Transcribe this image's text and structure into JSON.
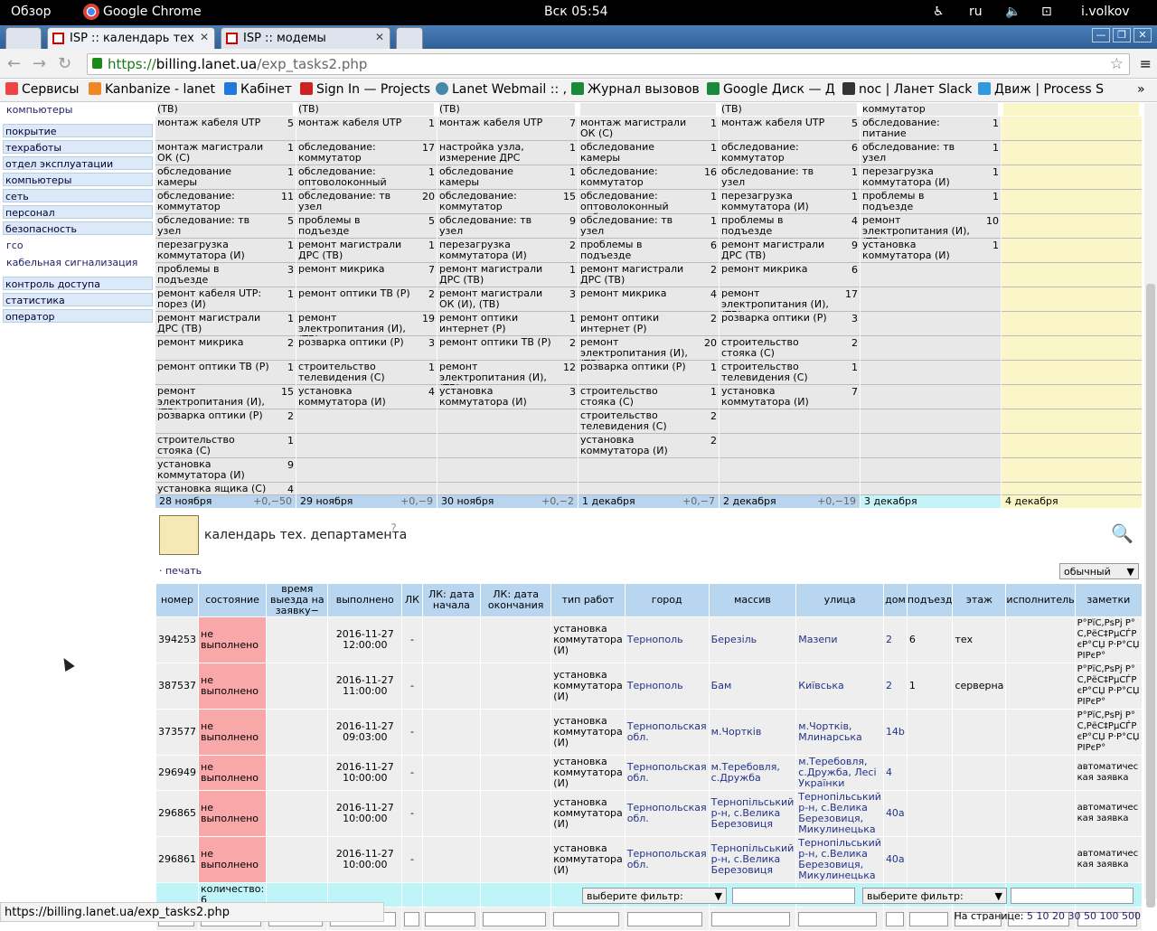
{
  "os": {
    "overview": "Обзор",
    "app": "Google Chrome",
    "clock": "Вск 05:54",
    "lang": "ru",
    "user": "i.volkov"
  },
  "tabs": [
    {
      "label": "ISP :: календарь тех"
    },
    {
      "label": "ISP :: модемы"
    }
  ],
  "address": {
    "scheme": "https://",
    "host": "billing.lanet.ua",
    "path": "/exp_tasks2.php"
  },
  "bookmarks": [
    "Сервисы",
    "Kanbanize - lanet",
    "Кабінет",
    "Sign In — Projects",
    "Lanet Webmail :: ,",
    "Журнал вызовов",
    "Google Диск — Д",
    "noc | Ланет Slack",
    "Движ | Process S"
  ],
  "sidebar": {
    "top_link": "компьютеры",
    "items": [
      "покрытие",
      "техработы",
      "отдел эксплуатации",
      "компьютеры",
      "сеть",
      "персонал",
      "безопасность"
    ],
    "sub_items": [
      "гсо",
      "кабельная сигнализация"
    ],
    "items2": [
      "контроль доступа",
      "статистика",
      "оператор"
    ]
  },
  "calendar": {
    "top_labels": [
      "(ТВ)",
      "(ТВ)",
      "(ТВ)",
      "",
      "(ТВ)",
      "коммутатор",
      ""
    ],
    "days": [
      {
        "date": "28 ноября",
        "delta": "+0,−50",
        "rows": [
          [
            "монтаж кабеля UTP",
            "5"
          ],
          [
            "монтаж магистрали ОК (С)",
            "1"
          ],
          [
            "обследование камеры",
            "1"
          ],
          [
            "обследование: коммутатор",
            "11"
          ],
          [
            "обследование: тв узел",
            "5"
          ],
          [
            "перезагрузка коммутатора (И)",
            "1"
          ],
          [
            "проблемы в подъезде",
            "3"
          ],
          [
            "ремонт кабеля UTP: порез (И)",
            "1"
          ],
          [
            "ремонт магистрали ДРС (ТВ)",
            "1"
          ],
          [
            "ремонт микрика",
            "2"
          ],
          [
            "ремонт оптики ТВ (Р)",
            "1"
          ],
          [
            "ремонт электропитания (И), (ТВ)",
            "15"
          ],
          [
            "розварка оптики (Р)",
            "2"
          ],
          [
            "строительство стояка (С)",
            "1"
          ],
          [
            "установка коммутатора (И)",
            "9"
          ],
          [
            "установка ящика (С)",
            "4"
          ]
        ]
      },
      {
        "date": "29 ноября",
        "delta": "+0,−9",
        "rows": [
          [
            "монтаж кабеля UTP",
            "1"
          ],
          [
            "обследование: коммутатор",
            "17"
          ],
          [
            "обследование: оптоволоконный кабель",
            "1"
          ],
          [
            "обследование: тв узел",
            "20"
          ],
          [
            "проблемы в подъезде",
            "5"
          ],
          [
            "ремонт магистрали ДРС (ТВ)",
            "1"
          ],
          [
            "ремонт микрика",
            "7"
          ],
          [
            "ремонт оптики ТВ (Р)",
            "2"
          ],
          [
            "ремонт электропитания (И), (ТВ)",
            "19"
          ],
          [
            "розварка оптики (Р)",
            "3"
          ],
          [
            "строительство телевидения (С)",
            "1"
          ],
          [
            "установка коммутатора (И)",
            "4"
          ]
        ]
      },
      {
        "date": "30 ноября",
        "delta": "+0,−2",
        "rows": [
          [
            "монтаж кабеля UTP",
            "7"
          ],
          [
            "настройка узла, измерение ДРС",
            "1"
          ],
          [
            "обследование камеры",
            "1"
          ],
          [
            "обследование: коммутатор",
            "15"
          ],
          [
            "обследование: тв узел",
            "9"
          ],
          [
            "перезагрузка коммутатора (И)",
            "2"
          ],
          [
            "ремонт магистрали ДРС (ТВ)",
            "1"
          ],
          [
            "ремонт магистрали ОК (И), (ТВ)",
            "3"
          ],
          [
            "ремонт оптики интернет (Р)",
            "1"
          ],
          [
            "ремонт оптики ТВ (Р)",
            "2"
          ],
          [
            "ремонт электропитания (И), (ТВ)",
            "12"
          ],
          [
            "установка коммутатора (И)",
            "3"
          ]
        ]
      },
      {
        "date": "1 декабря",
        "delta": "+0,−7",
        "rows": [
          [
            "монтаж магистрали ОК (С)",
            "1"
          ],
          [
            "обследование камеры",
            "1"
          ],
          [
            "обследование: коммутатор",
            "16"
          ],
          [
            "обследование: оптоволоконный кабель",
            "1"
          ],
          [
            "обследование: тв узел",
            "1"
          ],
          [
            "проблемы в подъезде",
            "6"
          ],
          [
            "ремонт магистрали ДРС (ТВ)",
            "2"
          ],
          [
            "ремонт микрика",
            "4"
          ],
          [
            "ремонт оптики интернет (Р)",
            "2"
          ],
          [
            "ремонт электропитания (И), (ТВ)",
            "20"
          ],
          [
            "розварка оптики (Р)",
            "1"
          ],
          [
            "строительство стояка (С)",
            "1"
          ],
          [
            "строительство телевидения (С)",
            "2"
          ],
          [
            "установка коммутатора (И)",
            "2"
          ]
        ]
      },
      {
        "date": "2 декабря",
        "delta": "+0,−19",
        "rows": [
          [
            "монтаж кабеля UTP",
            "5"
          ],
          [
            "обследование: коммутатор",
            "6"
          ],
          [
            "обследование: тв узел",
            "1"
          ],
          [
            "перезагрузка коммутатора (И)",
            "1"
          ],
          [
            "проблемы в подъезде",
            "4"
          ],
          [
            "ремонт магистрали ДРС (ТВ)",
            "9"
          ],
          [
            "ремонт микрика",
            "6"
          ],
          [
            "ремонт электропитания (И), (ТВ)",
            "17"
          ],
          [
            "розварка оптики (Р)",
            "3"
          ],
          [
            "строительство стояка (С)",
            "2"
          ],
          [
            "строительство телевидения (С)",
            "1"
          ],
          [
            "установка коммутатора (И)",
            "7"
          ]
        ]
      },
      {
        "date": "3 декабря",
        "delta": "",
        "rows": [
          [
            "обследование: питание",
            "1"
          ],
          [
            "обследование: тв узел",
            "1"
          ],
          [
            "перезагрузка коммутатора (И)",
            "1"
          ],
          [
            "проблемы в подъезде",
            "1"
          ],
          [
            "ремонт электропитания (И), (ТВ)",
            "10"
          ],
          [
            "установка коммутатора (И)",
            "1"
          ]
        ]
      },
      {
        "date": "4 декабря",
        "delta": "",
        "rows": []
      }
    ]
  },
  "section": {
    "title": "календарь тех. департамента",
    "help": "?",
    "print": "· печать",
    "mode": "обычный"
  },
  "table": {
    "headers": [
      "номер",
      "состояние",
      "время выезда на заявку−",
      "выполнено",
      "ЛК",
      "ЛК: дата начала",
      "ЛК: дата окончания",
      "тип работ",
      "город",
      "массив",
      "улица",
      "дом",
      "подъезд",
      "этаж",
      "исполнитель",
      "заметки"
    ],
    "rows": [
      [
        "394253",
        "не выполнено",
        "",
        "2016-11-27 12:00:00",
        "-",
        "",
        "",
        "установка коммутатора (И)",
        "Тернополь",
        "Березіль",
        "Мазепи",
        "2",
        "6",
        "тех",
        "",
        "Р°РїС‚РѕРј Р°С‚РёС‡РµСЃРєР°СЏ Р·Р°СЏРІРєР°"
      ],
      [
        "387537",
        "не выполнено",
        "",
        "2016-11-27 11:00:00",
        "-",
        "",
        "",
        "установка коммутатора (И)",
        "Тернополь",
        "Бам",
        "Київська",
        "2",
        "1",
        "серверна",
        "",
        "Р°РїС‚РѕРј Р°С‚РёС‡РµСЃРєР°СЏ Р·Р°СЏРІРєР°"
      ],
      [
        "373577",
        "не выполнено",
        "",
        "2016-11-27 09:03:00",
        "-",
        "",
        "",
        "установка коммутатора (И)",
        "Тернопольская обл.",
        "м.Чортків",
        "м.Чортків, Млинарська",
        "14b",
        "",
        "",
        "",
        "Р°РїС‚РѕРј Р°С‚РёС‡РµСЃРєР°СЏ Р·Р°СЏРІРєР°"
      ],
      [
        "296949",
        "не выполнено",
        "",
        "2016-11-27 10:00:00",
        "-",
        "",
        "",
        "установка коммутатора (И)",
        "Тернопольская обл.",
        "м.Теребовля, с.Дружба",
        "м.Теребовля, с.Дружба, Лесі Українки",
        "4",
        "",
        "",
        "",
        "автоматическая заявка"
      ],
      [
        "296865",
        "не выполнено",
        "",
        "2016-11-27 10:00:00",
        "-",
        "",
        "",
        "установка коммутатора (И)",
        "Тернопольская обл.",
        "Тернопільський р-н, с.Велика Березовиця",
        "Тернопільський р-н, с.Велика Березовиця, Микулинецька",
        "40а",
        "",
        "",
        "",
        "автоматическая заявка"
      ],
      [
        "296861",
        "не выполнено",
        "",
        "2016-11-27 10:00:00",
        "-",
        "",
        "",
        "установка коммутатора (И)",
        "Тернопольская обл.",
        "Тернопільський р-н, с.Велика Березовиця",
        "Тернопільський р-н, с.Велика Березовиця, Микулинецька",
        "40а",
        "",
        "",
        "",
        "автоматическая заявка"
      ]
    ],
    "count_label": "количество: 6"
  },
  "filters": {
    "select1": "выберите фильтр:",
    "select2": "выберите фильтр:"
  },
  "perpage": {
    "label": "На странице:",
    "options": [
      "5",
      "10",
      "20",
      "30",
      "50",
      "100",
      "500"
    ]
  },
  "status_url": "https://billing.lanet.ua/exp_tasks2.php"
}
